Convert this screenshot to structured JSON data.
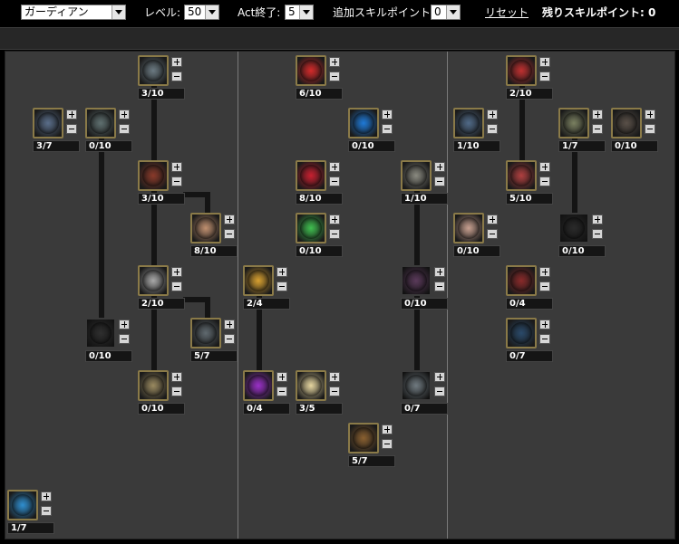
{
  "toolbar": {
    "class_select": "ガーディアン",
    "level_label": "レベル:",
    "level_value": "50",
    "act_label": "Act終了:",
    "act_value": "5",
    "extra_label": "追加スキルポイント:",
    "extra_value": "0",
    "reset_label": "リセット",
    "remaining_label": "残りスキルポイント: 0"
  },
  "colors": {
    "background": "#000000",
    "panel": "#3a3a3a",
    "frame": "#8a7a48",
    "divider": "#7a7a7a"
  },
  "skills": [
    {
      "id": "s1",
      "level": "3/10",
      "icon": "claw-strike-icon",
      "color": "#6b7a82"
    },
    {
      "id": "s2",
      "level": "3/7",
      "icon": "cannon-icon",
      "color": "#5a6e8a"
    },
    {
      "id": "s3",
      "level": "0/10",
      "icon": "armor-icon",
      "color": "#5f7070"
    },
    {
      "id": "s4",
      "level": "3/10",
      "icon": "fist-icon",
      "color": "#8a3a2a"
    },
    {
      "id": "s5",
      "level": "8/10",
      "icon": "explosion-icon",
      "color": "#c09070"
    },
    {
      "id": "s6",
      "level": "2/10",
      "icon": "shield-icon",
      "color": "#a9a9a9"
    },
    {
      "id": "s7",
      "level": "0/10",
      "icon": "stone-guard-icon",
      "color": "#2f2f2f"
    },
    {
      "id": "s8",
      "level": "5/7",
      "icon": "crest-icon",
      "color": "#606a70"
    },
    {
      "id": "s9",
      "level": "0/10",
      "icon": "round-shield-icon",
      "color": "#9a8a60"
    },
    {
      "id": "s10",
      "level": "6/10",
      "icon": "red-vortex-icon",
      "color": "#d42a2a"
    },
    {
      "id": "s11",
      "level": "0/10",
      "icon": "blue-vortex-icon",
      "color": "#1f7ad8"
    },
    {
      "id": "s12",
      "level": "8/10",
      "icon": "red-vortex-icon",
      "color": "#c82030"
    },
    {
      "id": "s13",
      "level": "1/10",
      "icon": "red-cross-icon",
      "color": "#8a8a80"
    },
    {
      "id": "s14",
      "level": "0/10",
      "icon": "rainbow-vortex-icon",
      "color": "#3fbf4f"
    },
    {
      "id": "s15",
      "level": "2/4",
      "icon": "gold-vortex-icon",
      "color": "#d8a030"
    },
    {
      "id": "s16",
      "level": "0/10",
      "icon": "gear-icon",
      "color": "#5a3a5a"
    },
    {
      "id": "s17",
      "level": "0/4",
      "icon": "purple-vortex-icon",
      "color": "#9a30c8"
    },
    {
      "id": "s18",
      "level": "3/5",
      "icon": "white-vortex-icon",
      "color": "#e6d6a0"
    },
    {
      "id": "s19",
      "level": "0/7",
      "icon": "cross-box-icon",
      "color": "#707a80"
    },
    {
      "id": "s20",
      "level": "5/7",
      "icon": "spiral-icon",
      "color": "#8a6030"
    },
    {
      "id": "s21",
      "level": "2/10",
      "icon": "blade-flurry-icon",
      "color": "#c03030"
    },
    {
      "id": "s22",
      "level": "1/10",
      "icon": "sword-icon",
      "color": "#506a88"
    },
    {
      "id": "s23",
      "level": "1/7",
      "icon": "hammer-icon",
      "color": "#7a8060"
    },
    {
      "id": "s24",
      "level": "0/10",
      "icon": "gauntlet-icon",
      "color": "#5a5048"
    },
    {
      "id": "s25",
      "level": "5/10",
      "icon": "red-blade-icon",
      "color": "#b04040"
    },
    {
      "id": "s26",
      "level": "0/10",
      "icon": "burst-icon",
      "color": "#c8a090"
    },
    {
      "id": "s27",
      "level": "0/10",
      "icon": "dark-guard-icon",
      "color": "#2a2a2a"
    },
    {
      "id": "s28",
      "level": "0/4",
      "icon": "red-sigil-icon",
      "color": "#8a2a2a"
    },
    {
      "id": "s29",
      "level": "0/7",
      "icon": "lightning-icon",
      "color": "#2a4a6a"
    },
    {
      "id": "s30",
      "level": "1/7",
      "icon": "chevron-up-icon",
      "color": "#2f8fd0"
    }
  ]
}
